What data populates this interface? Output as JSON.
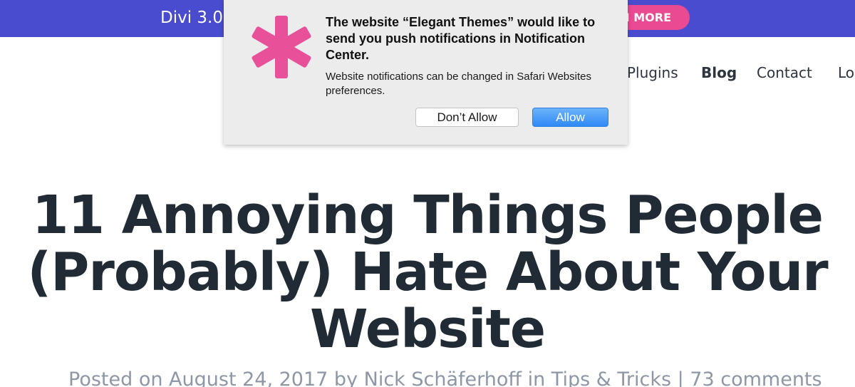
{
  "promo": {
    "text": "Divi 3.0",
    "button_label": "N MORE"
  },
  "nav": {
    "items": [
      {
        "label": "Plugins"
      },
      {
        "label": "Blog"
      },
      {
        "label": "Contact"
      },
      {
        "label": "Lo"
      }
    ]
  },
  "article": {
    "title_lines": [
      "11 Annoying Things People",
      "(Probably) Hate About Your",
      "Website"
    ],
    "meta": "Posted on August 24, 2017 by Nick Schäferhoff in Tips & Tricks | 73 comments"
  },
  "dialog": {
    "title": "The website “Elegant Themes” would like to send you push notifications in Notification Center.",
    "body": "Website notifications can be changed in Safari Websites preferences.",
    "deny_label": "Don’t Allow",
    "allow_label": "Allow",
    "icon": "asterisk-logo-icon"
  },
  "colors": {
    "promo_bar": "#4a4cd0",
    "promo_button": "#ea4a92",
    "logo_pink": "#e8509a",
    "title_text": "#212b35",
    "meta_text": "#8d97a6",
    "allow_blue": "#2f8af5"
  }
}
